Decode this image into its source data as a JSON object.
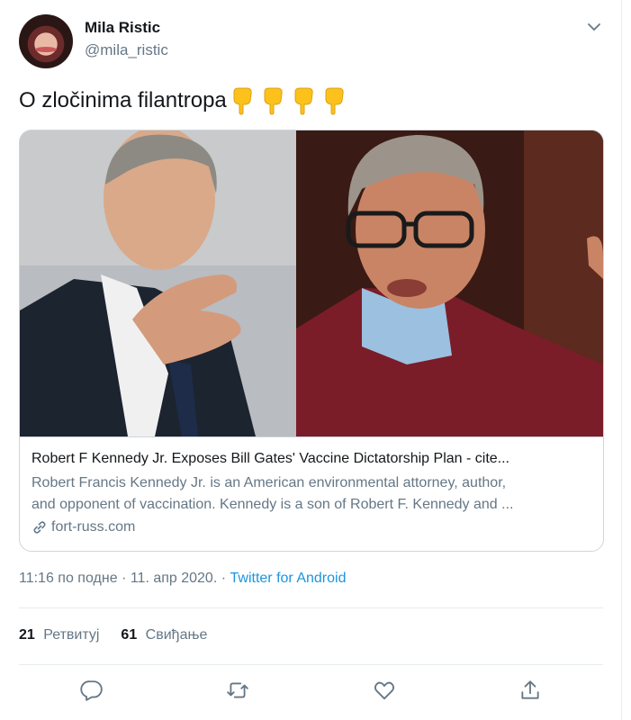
{
  "user": {
    "name": "Mila Ristic",
    "handle": "@mila_ristic"
  },
  "tweet": {
    "text": "O zločinima filantropa",
    "emoji_count": 4
  },
  "card": {
    "title": "Robert F Kennedy Jr. Exposes Bill Gates' Vaccine Dictatorship Plan - cite...",
    "description_line1": "Robert Francis Kennedy Jr. is an American environmental attorney, author,",
    "description_line2": "and opponent of vaccination. Kennedy is a son of Robert F. Kennedy and ...",
    "domain": "fort-russ.com"
  },
  "meta": {
    "time": "11:16 по подне",
    "date": "11. апр 2020.",
    "source": "Twitter for Android"
  },
  "stats": {
    "retweets_count": "21",
    "retweets_label": "Ретвитуј",
    "likes_count": "61",
    "likes_label": "Свиђање"
  },
  "icons": [
    "chevron-down-icon",
    "reply-icon",
    "retweet-icon",
    "like-icon",
    "share-icon",
    "link-icon"
  ],
  "colors": {
    "link": "#1b95e0",
    "secondary_text": "#657786",
    "border": "#e6ecf0"
  }
}
